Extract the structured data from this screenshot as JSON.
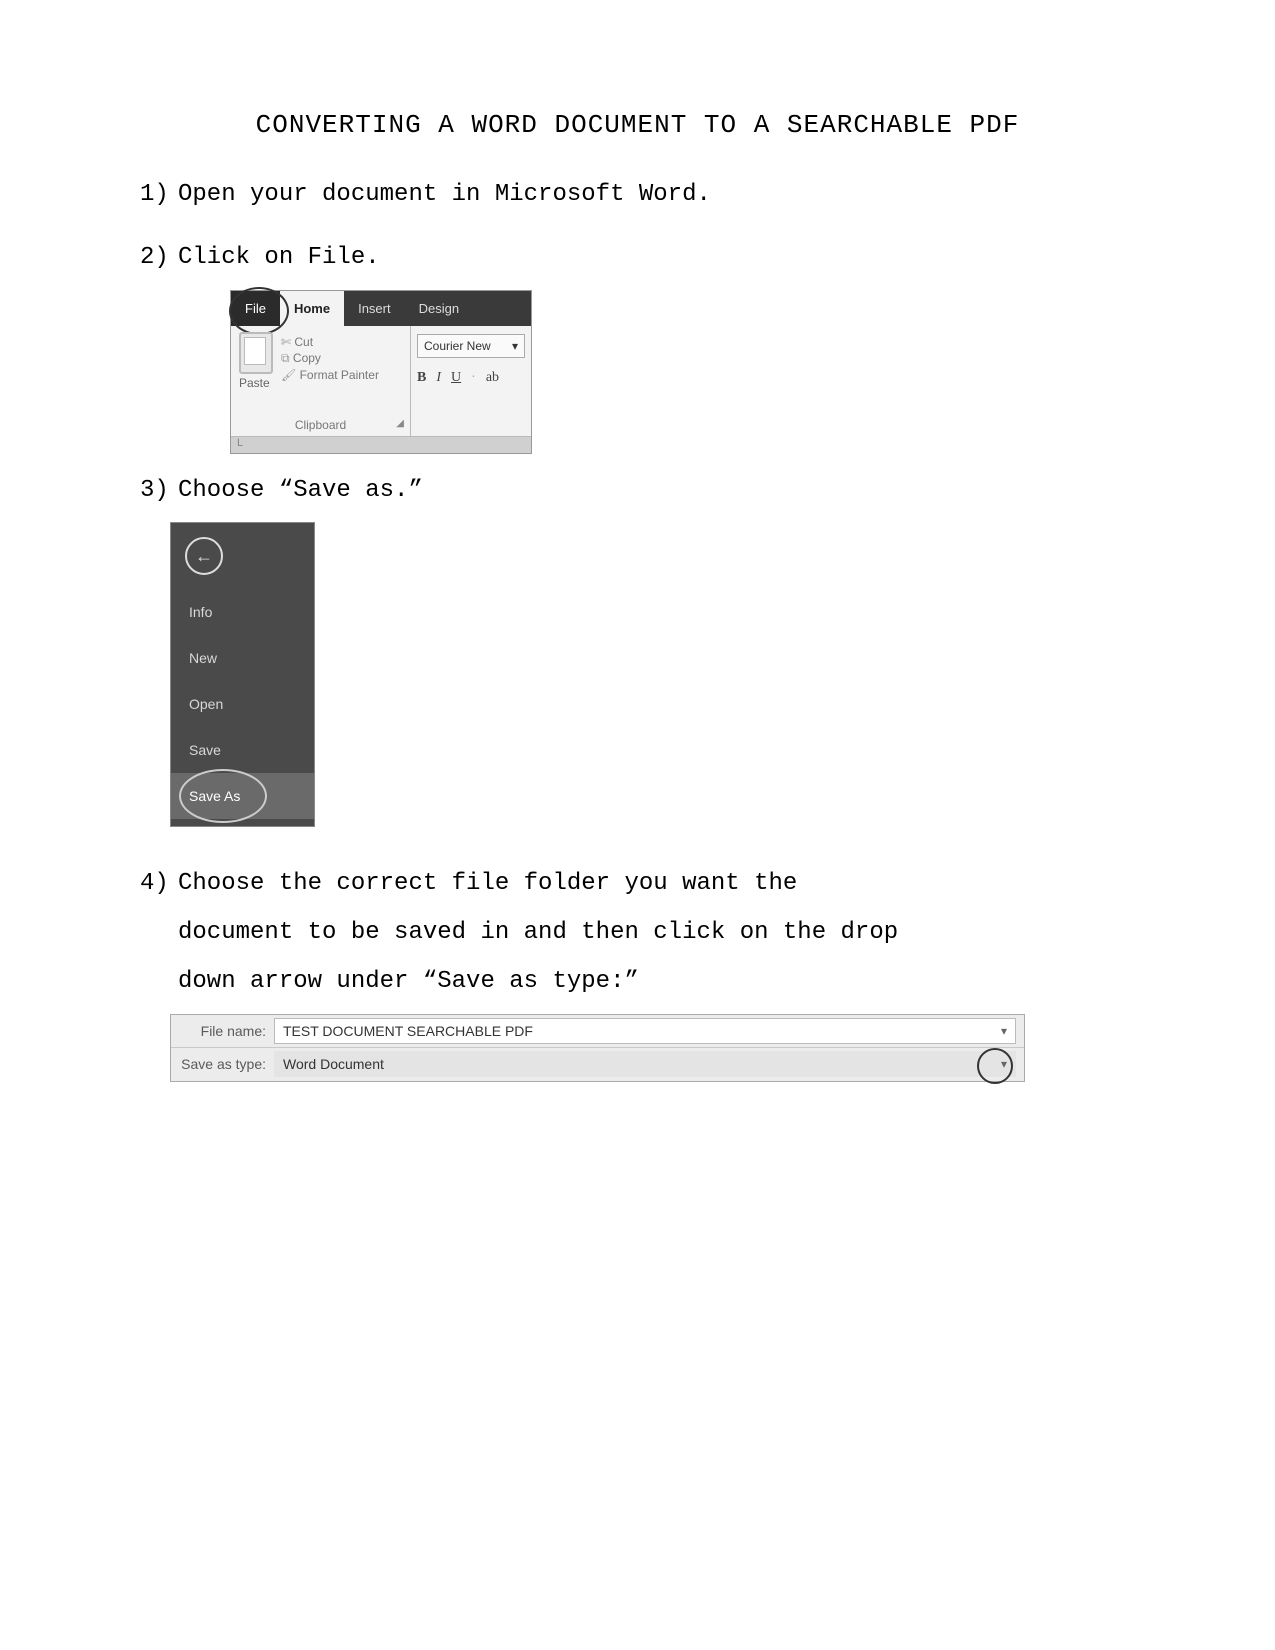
{
  "title": "CONVERTING A WORD DOCUMENT TO A SEARCHABLE PDF",
  "steps": {
    "s1_num": "1)",
    "s1_text": "Open your document in Microsoft Word.",
    "s2_num": "2)",
    "s2_text": "Click on File.",
    "s3_num": "3)",
    "s3_text": "Choose “Save as.”",
    "s4_num": "4)",
    "s4_line1": "Choose the correct file folder you want the",
    "s4_line2": "document to be saved in and then click on the drop",
    "s4_line3": "down arrow under “Save as type:”"
  },
  "ribbon": {
    "tabs": {
      "file": "File",
      "home": "Home",
      "insert": "Insert",
      "design": "Design"
    },
    "cut": "Cut",
    "copy": "Copy",
    "format_painter": "Format Painter",
    "paste": "Paste",
    "clipboard": "Clipboard",
    "font_name": "Courier New",
    "b": "B",
    "i": "I",
    "u": "U",
    "abc": "ab"
  },
  "filemenu": {
    "info": "Info",
    "new": "New",
    "open": "Open",
    "save": "Save",
    "save_as": "Save As"
  },
  "savebar": {
    "file_name_label": "File name:",
    "file_name_value": "TEST DOCUMENT SEARCHABLE PDF",
    "save_type_label": "Save as type:",
    "save_type_value": "Word Document"
  }
}
